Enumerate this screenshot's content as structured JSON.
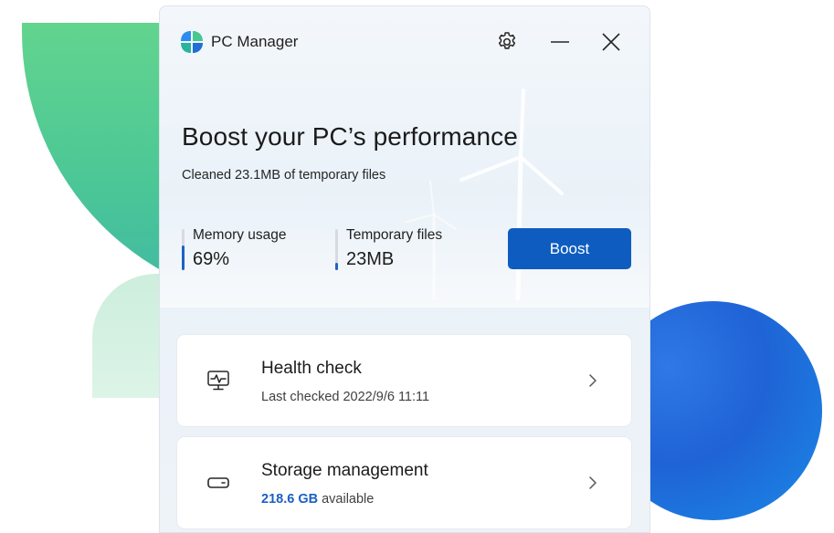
{
  "app": {
    "name": "PC Manager"
  },
  "titlebar": {
    "settings_icon": "gear-icon",
    "minimize_icon": "minimize-icon",
    "close_icon": "close-icon"
  },
  "hero": {
    "headline": "Boost your PC’s performance",
    "subtitle": "Cleaned 23.1MB of temporary files"
  },
  "metrics": {
    "memory": {
      "label": "Memory usage",
      "value": "69%",
      "level_percent": 69
    },
    "temp": {
      "label": "Temporary files",
      "value": "23MB",
      "level_percent": 20
    }
  },
  "boost_button": {
    "label": "Boost"
  },
  "cards": {
    "health": {
      "title": "Health check",
      "subtitle": "Last checked 2022/9/6 11:11",
      "icon": "health-monitor-icon"
    },
    "storage": {
      "title": "Storage management",
      "size": "218.6 GB",
      "suffix": " available",
      "icon": "drive-icon"
    }
  },
  "colors": {
    "accent": "#0f5cc0",
    "link": "#1a5fc4",
    "bg_green": "#4cc796",
    "bg_blue": "#1f63d6"
  }
}
